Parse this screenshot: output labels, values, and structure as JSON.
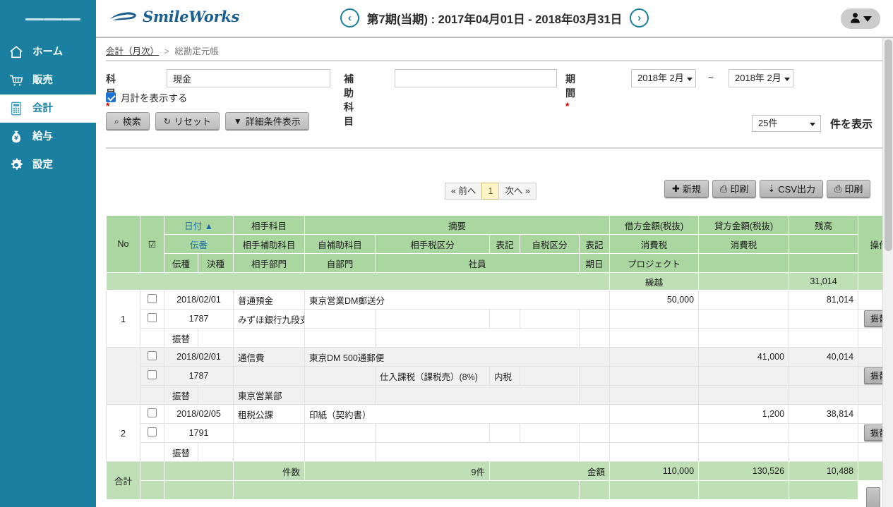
{
  "brand": {
    "name": "SmileWorks",
    "accent": "#1a7fa0",
    "table_header_green": "#aad6a0"
  },
  "sidebar": {
    "menu_icon": "hamburger-icon",
    "items": [
      {
        "label": "ホーム",
        "icon": "home-icon",
        "active": false
      },
      {
        "label": "販売",
        "icon": "cart-icon",
        "active": false
      },
      {
        "label": "会計",
        "icon": "calculator-icon",
        "active": true
      },
      {
        "label": "給与",
        "icon": "money-bag-icon",
        "active": false
      },
      {
        "label": "設定",
        "icon": "gear-icon",
        "active": false
      }
    ]
  },
  "topbar": {
    "period_text": "第7期(当期) : 2017年04月01日 - 2018年03月31日",
    "prev_icon": "chevron-left-icon",
    "next_icon": "chevron-right-icon",
    "user_icon": "user-icon",
    "user_caret": "chevron-down-icon"
  },
  "breadcrumb": {
    "parent": "会計（月次）",
    "separator": ">",
    "current": "総勘定元帳"
  },
  "search_form": {
    "kamoku_label": "科目",
    "kamoku_required": "*",
    "kamoku_value": "現金",
    "hojo_label": "補助科目",
    "hojo_value": "",
    "kikan_label": "期間",
    "kikan_required": "*",
    "date_from": "2018年 2月",
    "date_tilde": "~",
    "date_to": "2018年 2月",
    "monthly_checkbox_label": "月計を表示する",
    "monthly_checkbox_checked": true,
    "buttons": [
      {
        "label": "検索",
        "icon": "search-icon",
        "glyph": "⌕"
      },
      {
        "label": "リセット",
        "icon": "refresh-icon",
        "glyph": "↻"
      },
      {
        "label": "詳細条件表示",
        "icon": "filter-icon",
        "glyph": "▼"
      }
    ],
    "per_page_value": "25件",
    "per_page_suffix": "件を表示"
  },
  "pagination": {
    "prev": "« 前へ",
    "current": "1",
    "next": "次へ »"
  },
  "actions": [
    {
      "label": "新規",
      "icon": "plus-icon",
      "glyph": "✚"
    },
    {
      "label": "印刷",
      "icon": "printer-icon",
      "glyph": "⎙"
    },
    {
      "label": "CSV出力",
      "icon": "download-icon",
      "glyph": "⇣"
    },
    {
      "label": "印刷",
      "icon": "printer-icon",
      "glyph": "⎙"
    }
  ],
  "table": {
    "header_row1": {
      "no": "No",
      "check": "☑",
      "date": "日付",
      "date_sort": "▲",
      "counter_account": "相手科目",
      "summary": "摘要",
      "debit": "借方金額(税抜)",
      "credit": "貸方金額(税抜)",
      "balance": "残高",
      "operation": "操作"
    },
    "header_row2": {
      "slip_no": "伝番",
      "counter_sub_account": "相手補助科目",
      "own_sub_account": "自補助科目",
      "counter_tax_class": "相手税区分",
      "notation1": "表記",
      "own_tax_class": "自税区分",
      "notation2": "表記",
      "consumption_tax_debit": "消費税",
      "consumption_tax_credit": "消費税"
    },
    "header_row3": {
      "slip_type": "伝種",
      "settle_type": "決種",
      "counter_dept": "相手部門",
      "own_dept": "自部門",
      "employee": "社員",
      "due_date": "期日",
      "project": "プロジェクト"
    },
    "carryover": {
      "label": "繰越",
      "amount": "31,014"
    },
    "entries": [
      {
        "no": "1",
        "alt": false,
        "line1": {
          "date": "2018/02/01",
          "counter_account": "普通預金",
          "summary": "東京営業DM郵送分",
          "debit": "50,000",
          "credit": "",
          "balance": "81,014"
        },
        "line2": {
          "slip_no": "1787",
          "counter_sub_account": "みずほ銀行九段支店",
          "own_sub_account": "",
          "counter_tax_class": "",
          "notation1": "",
          "own_tax_class": "",
          "notation2": "",
          "tax_debit": "",
          "tax_credit": "",
          "op": "振替"
        },
        "line3": {
          "slip_type": "振替",
          "settle_type": "",
          "counter_dept": "",
          "own_dept": "",
          "employee": "",
          "due_date": "",
          "project": ""
        }
      },
      {
        "no": "",
        "alt": true,
        "line1": {
          "date": "2018/02/01",
          "counter_account": "通信費",
          "summary": "東京DM 500通郵便",
          "debit": "",
          "credit": "41,000",
          "balance": "40,014"
        },
        "line2": {
          "slip_no": "1787",
          "counter_sub_account": "",
          "own_sub_account": "",
          "counter_tax_class": "仕入課税（課税売）(8%)",
          "notation1": "内税",
          "own_tax_class": "",
          "notation2": "",
          "tax_debit": "",
          "tax_credit": "",
          "op": "振替"
        },
        "line3": {
          "slip_type": "振替",
          "settle_type": "",
          "counter_dept": "東京営業部",
          "own_dept": "",
          "employee": "",
          "due_date": "",
          "project": ""
        }
      },
      {
        "no": "2",
        "alt": false,
        "line1": {
          "date": "2018/02/05",
          "counter_account": "租税公課",
          "summary": "印紙（契約書）",
          "debit": "",
          "credit": "1,200",
          "balance": "38,814"
        },
        "line2": {
          "slip_no": "1791",
          "counter_sub_account": "",
          "own_sub_account": "",
          "counter_tax_class": "",
          "notation1": "",
          "own_tax_class": "",
          "notation2": "",
          "tax_debit": "",
          "tax_credit": "",
          "op": "振替"
        },
        "line3": {
          "slip_type": "振替",
          "settle_type": "",
          "counter_dept": "",
          "own_dept": "",
          "employee": "",
          "due_date": "",
          "project": ""
        }
      }
    ],
    "footer": {
      "total_label": "合計",
      "count_label": "件数",
      "count_value": "9件",
      "amount_label": "金額",
      "debit_total": "110,000",
      "credit_total": "130,526",
      "balance_total": "10,488"
    }
  }
}
